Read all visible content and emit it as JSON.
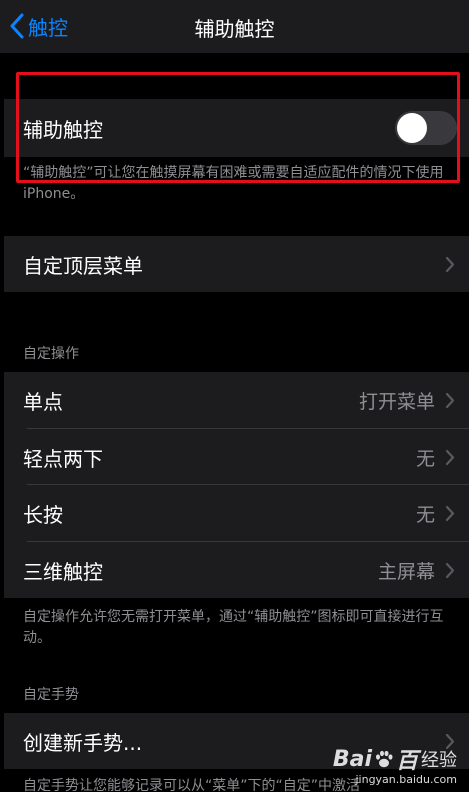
{
  "navbar": {
    "back_label": "触控",
    "title": "辅助触控"
  },
  "assistive_touch": {
    "label": "辅助触控",
    "toggle_on": false,
    "footnote": "“辅助触控”可让您在触摸屏幕有困难或需要自适应配件的情况下使用iPhone。"
  },
  "top_menu": {
    "label": "自定顶层菜单"
  },
  "custom_actions": {
    "header": "自定操作",
    "rows": [
      {
        "label": "单点",
        "value": "打开菜单"
      },
      {
        "label": "轻点两下",
        "value": "无"
      },
      {
        "label": "长按",
        "value": "无"
      },
      {
        "label": "三维触控",
        "value": "主屏幕"
      }
    ],
    "footnote": "自定操作允许您无需打开菜单，通过“辅助触控”图标即可直接进行互动。"
  },
  "custom_gestures": {
    "header": "自定手势",
    "create_label": "创建新手势...",
    "footnote": "自定手势让您能够记录可以从“菜单”下的“自定”中激活"
  },
  "watermark": {
    "brand_left": "Bai",
    "brand_right": "百",
    "suffix": "经验",
    "url": "jingyan.baidu.com"
  },
  "colors": {
    "accent": "#0a84ff",
    "highlight": "#e3101b",
    "cell_bg": "#1c1c1e",
    "secondary_text": "#8e8e93"
  }
}
